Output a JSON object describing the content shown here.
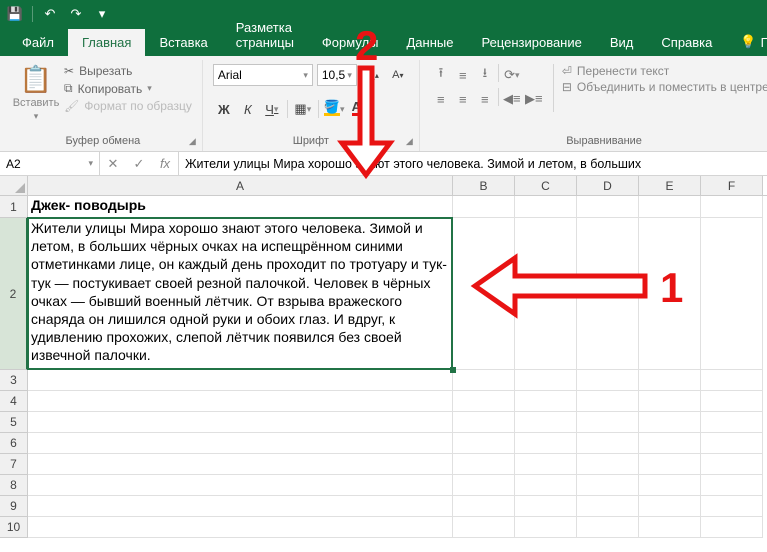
{
  "qat": {
    "save": "💾",
    "undo": "↶",
    "redo": "↷",
    "touch": "▾"
  },
  "tabs": {
    "file": "Файл",
    "home": "Главная",
    "insert": "Вставка",
    "layout": "Разметка страницы",
    "formulas": "Формулы",
    "data": "Данные",
    "review": "Рецензирование",
    "view": "Вид",
    "help": "Справка",
    "tell": "По"
  },
  "clipboard": {
    "paste": "Вставить",
    "cut": "Вырезать",
    "copy": "Копировать",
    "format": "Формат по образцу",
    "group": "Буфер обмена"
  },
  "font": {
    "name": "Arial",
    "size": "10,5",
    "grow": "A",
    "shrink": "A",
    "bold": "Ж",
    "italic": "К",
    "underline": "Ч",
    "group": "Шрифт"
  },
  "align": {
    "wrap": "Перенести текст",
    "merge": "Объединить и поместить в центре",
    "group": "Выравнивание"
  },
  "namebox": "A2",
  "formula": "Жители улицы Мира хорошо знают этого человека. Зимой и летом, в больших",
  "cols": [
    "A",
    "B",
    "C",
    "D",
    "E",
    "F"
  ],
  "rownums": [
    "1",
    "2",
    "3",
    "4",
    "5",
    "6",
    "7",
    "8",
    "9",
    "10"
  ],
  "cell_a1": "Джек- поводырь",
  "cell_a2": "Жители улицы Мира хорошо знают этого человека. Зимой и летом, в больших чёрных очках на испещрённом синими отметинками лице, он каждый день проходит по тротуару и тук-тук — постукивает своей резной палочкой. Человек в чёрных очках — бывший военный лётчик. От взрыва вражеского снаряда он лишился одной руки и обоих глаз. И вдруг, к удивлению прохожих, слепой лётчик появился без своей извечной палочки.",
  "anno": {
    "one": "1",
    "two": "2"
  }
}
